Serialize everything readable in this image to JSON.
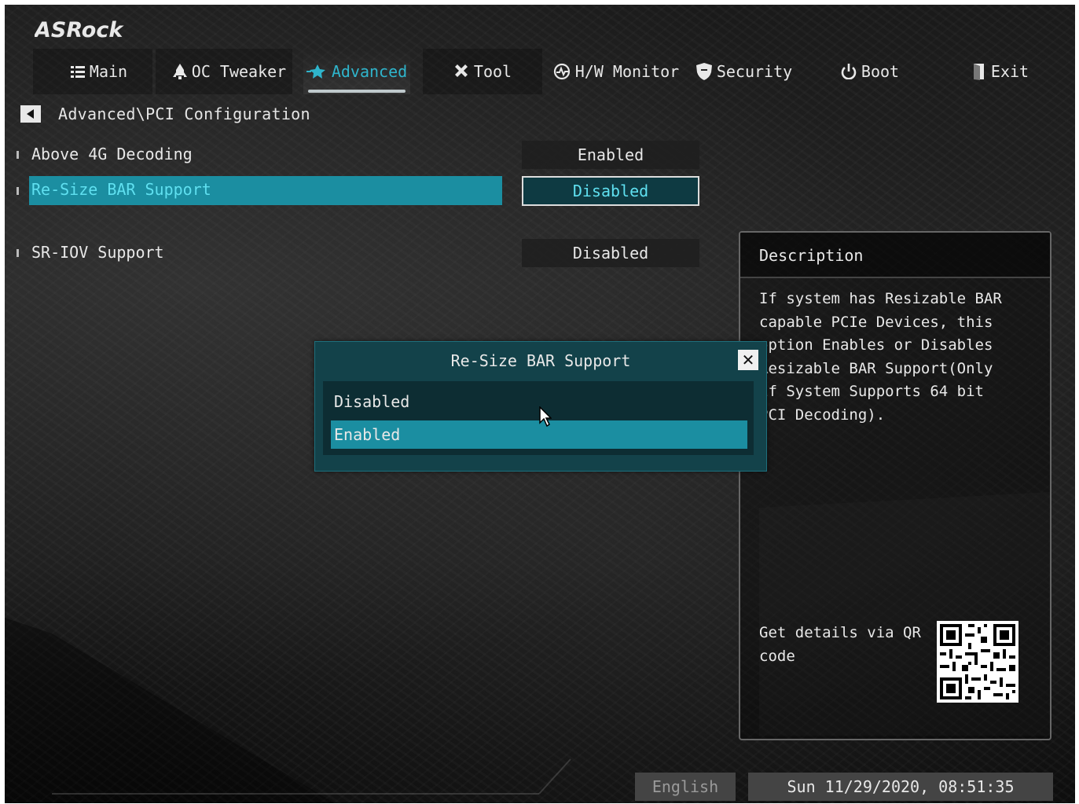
{
  "brand": "ASRock",
  "tabs": [
    {
      "label": "Main",
      "icon": "list-icon"
    },
    {
      "label": "OC Tweaker",
      "icon": "rocket-icon"
    },
    {
      "label": "Advanced",
      "icon": "star-icon",
      "active": true
    },
    {
      "label": "Tool",
      "icon": "tools-icon"
    },
    {
      "label": "H/W Monitor",
      "icon": "monitor-icon"
    },
    {
      "label": "Security",
      "icon": "shield-icon"
    },
    {
      "label": "Boot",
      "icon": "power-icon"
    },
    {
      "label": "Exit",
      "icon": "exit-door-icon"
    }
  ],
  "breadcrumb": "Advanced\\PCI Configuration",
  "settings": [
    {
      "label": "Above 4G Decoding",
      "value": "Enabled"
    },
    {
      "label": "Re-Size BAR Support",
      "value": "Disabled",
      "selected": true
    },
    {
      "label": "SR-IOV Support",
      "value": "Disabled"
    }
  ],
  "description": {
    "title": "Description",
    "body": "If system has Resizable BAR capable PCIe Devices, this option Enables or Disables Resizable BAR Support(Only if System Supports 64 bit PCI Decoding).",
    "qr_text": "Get details via QR code"
  },
  "popup": {
    "title": "Re-Size BAR Support",
    "options": [
      "Disabled",
      "Enabled"
    ],
    "selected_index": 1
  },
  "footer": {
    "language": "English",
    "datetime": "Sun 11/29/2020, 08:51:35"
  },
  "colors": {
    "accent": "#1b8ea1",
    "accent_text": "#5fe0f0",
    "active_tab": "#2fb5cc"
  }
}
